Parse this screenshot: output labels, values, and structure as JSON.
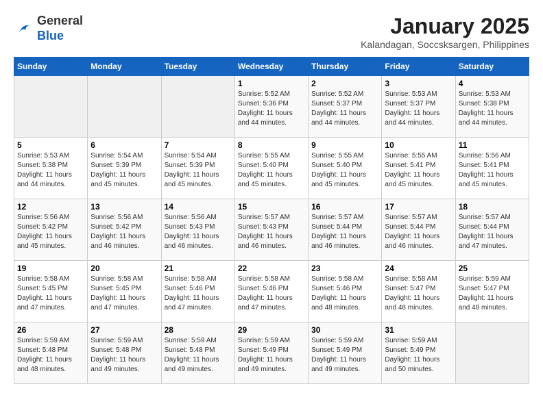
{
  "logo": {
    "general": "General",
    "blue": "Blue"
  },
  "title": "January 2025",
  "subtitle": "Kalandagan, Soccsksargen, Philippines",
  "days_of_week": [
    "Sunday",
    "Monday",
    "Tuesday",
    "Wednesday",
    "Thursday",
    "Friday",
    "Saturday"
  ],
  "weeks": [
    [
      {
        "day": "",
        "info": ""
      },
      {
        "day": "",
        "info": ""
      },
      {
        "day": "",
        "info": ""
      },
      {
        "day": "1",
        "info": "Sunrise: 5:52 AM\nSunset: 5:36 PM\nDaylight: 11 hours and 44 minutes."
      },
      {
        "day": "2",
        "info": "Sunrise: 5:52 AM\nSunset: 5:37 PM\nDaylight: 11 hours and 44 minutes."
      },
      {
        "day": "3",
        "info": "Sunrise: 5:53 AM\nSunset: 5:37 PM\nDaylight: 11 hours and 44 minutes."
      },
      {
        "day": "4",
        "info": "Sunrise: 5:53 AM\nSunset: 5:38 PM\nDaylight: 11 hours and 44 minutes."
      }
    ],
    [
      {
        "day": "5",
        "info": "Sunrise: 5:53 AM\nSunset: 5:38 PM\nDaylight: 11 hours and 44 minutes."
      },
      {
        "day": "6",
        "info": "Sunrise: 5:54 AM\nSunset: 5:39 PM\nDaylight: 11 hours and 45 minutes."
      },
      {
        "day": "7",
        "info": "Sunrise: 5:54 AM\nSunset: 5:39 PM\nDaylight: 11 hours and 45 minutes."
      },
      {
        "day": "8",
        "info": "Sunrise: 5:55 AM\nSunset: 5:40 PM\nDaylight: 11 hours and 45 minutes."
      },
      {
        "day": "9",
        "info": "Sunrise: 5:55 AM\nSunset: 5:40 PM\nDaylight: 11 hours and 45 minutes."
      },
      {
        "day": "10",
        "info": "Sunrise: 5:55 AM\nSunset: 5:41 PM\nDaylight: 11 hours and 45 minutes."
      },
      {
        "day": "11",
        "info": "Sunrise: 5:56 AM\nSunset: 5:41 PM\nDaylight: 11 hours and 45 minutes."
      }
    ],
    [
      {
        "day": "12",
        "info": "Sunrise: 5:56 AM\nSunset: 5:42 PM\nDaylight: 11 hours and 45 minutes."
      },
      {
        "day": "13",
        "info": "Sunrise: 5:56 AM\nSunset: 5:42 PM\nDaylight: 11 hours and 46 minutes."
      },
      {
        "day": "14",
        "info": "Sunrise: 5:56 AM\nSunset: 5:43 PM\nDaylight: 11 hours and 46 minutes."
      },
      {
        "day": "15",
        "info": "Sunrise: 5:57 AM\nSunset: 5:43 PM\nDaylight: 11 hours and 46 minutes."
      },
      {
        "day": "16",
        "info": "Sunrise: 5:57 AM\nSunset: 5:44 PM\nDaylight: 11 hours and 46 minutes."
      },
      {
        "day": "17",
        "info": "Sunrise: 5:57 AM\nSunset: 5:44 PM\nDaylight: 11 hours and 46 minutes."
      },
      {
        "day": "18",
        "info": "Sunrise: 5:57 AM\nSunset: 5:44 PM\nDaylight: 11 hours and 47 minutes."
      }
    ],
    [
      {
        "day": "19",
        "info": "Sunrise: 5:58 AM\nSunset: 5:45 PM\nDaylight: 11 hours and 47 minutes."
      },
      {
        "day": "20",
        "info": "Sunrise: 5:58 AM\nSunset: 5:45 PM\nDaylight: 11 hours and 47 minutes."
      },
      {
        "day": "21",
        "info": "Sunrise: 5:58 AM\nSunset: 5:46 PM\nDaylight: 11 hours and 47 minutes."
      },
      {
        "day": "22",
        "info": "Sunrise: 5:58 AM\nSunset: 5:46 PM\nDaylight: 11 hours and 47 minutes."
      },
      {
        "day": "23",
        "info": "Sunrise: 5:58 AM\nSunset: 5:46 PM\nDaylight: 11 hours and 48 minutes."
      },
      {
        "day": "24",
        "info": "Sunrise: 5:58 AM\nSunset: 5:47 PM\nDaylight: 11 hours and 48 minutes."
      },
      {
        "day": "25",
        "info": "Sunrise: 5:59 AM\nSunset: 5:47 PM\nDaylight: 11 hours and 48 minutes."
      }
    ],
    [
      {
        "day": "26",
        "info": "Sunrise: 5:59 AM\nSunset: 5:48 PM\nDaylight: 11 hours and 48 minutes."
      },
      {
        "day": "27",
        "info": "Sunrise: 5:59 AM\nSunset: 5:48 PM\nDaylight: 11 hours and 49 minutes."
      },
      {
        "day": "28",
        "info": "Sunrise: 5:59 AM\nSunset: 5:48 PM\nDaylight: 11 hours and 49 minutes."
      },
      {
        "day": "29",
        "info": "Sunrise: 5:59 AM\nSunset: 5:49 PM\nDaylight: 11 hours and 49 minutes."
      },
      {
        "day": "30",
        "info": "Sunrise: 5:59 AM\nSunset: 5:49 PM\nDaylight: 11 hours and 49 minutes."
      },
      {
        "day": "31",
        "info": "Sunrise: 5:59 AM\nSunset: 5:49 PM\nDaylight: 11 hours and 50 minutes."
      },
      {
        "day": "",
        "info": ""
      }
    ]
  ]
}
